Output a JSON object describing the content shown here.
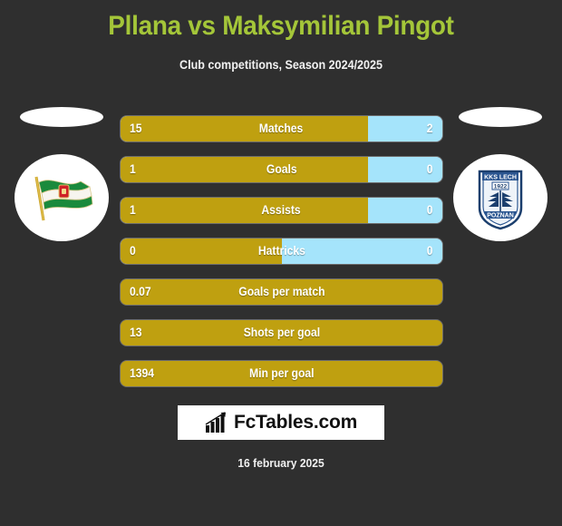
{
  "header": {
    "title": "Pllana vs Maksymilian Pingot",
    "subtitle": "Club competitions, Season 2024/2025",
    "title_color": "#a4c639"
  },
  "badges": {
    "left": {
      "name": "lechia-gdansk-pennant",
      "alt": "Green and white pennant flag club crest"
    },
    "right": {
      "name": "lech-poznan-crest",
      "line1": "KKS LECH",
      "year": "1922",
      "line2": "POZNAN"
    }
  },
  "colors": {
    "background": "#2f2f2f",
    "left_bar": "#bfa010",
    "right_bar": "#a5e4fb",
    "accent": "#a4c639"
  },
  "chart_data": {
    "type": "bar",
    "title": "Pllana vs Maksymilian Pingot",
    "subtitle": "Club competitions, Season 2024/2025",
    "orientation": "horizontal-paired",
    "series": [
      {
        "name": "Pllana",
        "color": "#bfa010"
      },
      {
        "name": "Maksymilian Pingot",
        "color": "#a5e4fb"
      }
    ],
    "categories": [
      "Matches",
      "Goals",
      "Assists",
      "Hattricks",
      "Goals per match",
      "Shots per goal",
      "Min per goal"
    ],
    "rows": [
      {
        "label": "Matches",
        "left": "15",
        "right": "2",
        "left_pct": 77,
        "split": true
      },
      {
        "label": "Goals",
        "left": "1",
        "right": "0",
        "left_pct": 77,
        "split": true
      },
      {
        "label": "Assists",
        "left": "1",
        "right": "0",
        "left_pct": 77,
        "split": true
      },
      {
        "label": "Hattricks",
        "left": "0",
        "right": "0",
        "left_pct": 50,
        "split": true
      },
      {
        "label": "Goals per match",
        "left": "0.07",
        "right": "",
        "left_pct": 100,
        "split": false
      },
      {
        "label": "Shots per goal",
        "left": "13",
        "right": "",
        "left_pct": 100,
        "split": false
      },
      {
        "label": "Min per goal",
        "left": "1394",
        "right": "",
        "left_pct": 100,
        "split": false
      }
    ]
  },
  "footer": {
    "logo_text": "FcTables.com",
    "logo_icon": "bar-chart-icon",
    "date": "16 february 2025"
  }
}
